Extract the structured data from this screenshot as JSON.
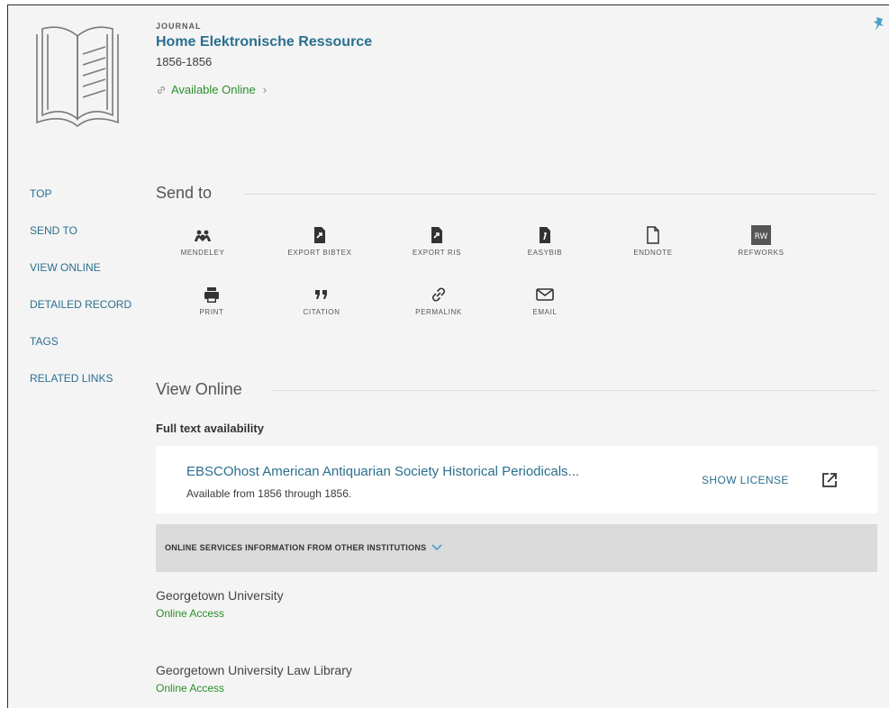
{
  "record": {
    "type": "JOURNAL",
    "title": "Home Elektronische Ressource",
    "years": "1856-1856",
    "availability": "Available Online"
  },
  "sidenav": {
    "items": [
      "TOP",
      "SEND TO",
      "VIEW ONLINE",
      "DETAILED RECORD",
      "TAGS",
      "RELATED LINKS"
    ]
  },
  "send_to": {
    "title": "Send to",
    "actions": [
      {
        "label": "MENDELEY",
        "icon": "mendeley-icon"
      },
      {
        "label": "EXPORT BIBTEX",
        "icon": "export-bibtex-icon"
      },
      {
        "label": "EXPORT RIS",
        "icon": "export-ris-icon"
      },
      {
        "label": "EASYBIB",
        "icon": "easybib-icon"
      },
      {
        "label": "ENDNOTE",
        "icon": "endnote-icon"
      },
      {
        "label": "REFWORKS",
        "icon": "refworks-icon",
        "badge": "RW"
      },
      {
        "label": "PRINT",
        "icon": "print-icon"
      },
      {
        "label": "CITATION",
        "icon": "citation-icon"
      },
      {
        "label": "PERMALINK",
        "icon": "permalink-icon"
      },
      {
        "label": "EMAIL",
        "icon": "email-icon"
      }
    ]
  },
  "view_online": {
    "title": "View Online",
    "fulltext_label": "Full text availability",
    "service": {
      "name": "EBSCOhost American Antiquarian Society Historical Periodicals...",
      "range": "Available from 1856 through 1856.",
      "show_license": "SHOW LICENSE"
    },
    "other_label": "ONLINE SERVICES INFORMATION FROM OTHER INSTITUTIONS",
    "institutions": [
      {
        "name": "Georgetown University",
        "access": "Online Access"
      },
      {
        "name": "Georgetown University Law Library",
        "access": "Online Access"
      }
    ]
  },
  "colors": {
    "link": "#2a6f8f",
    "available": "#2a8f2a",
    "accent": "#4aa3c8",
    "panel": "#f4f4f4",
    "bar": "#dadada"
  }
}
